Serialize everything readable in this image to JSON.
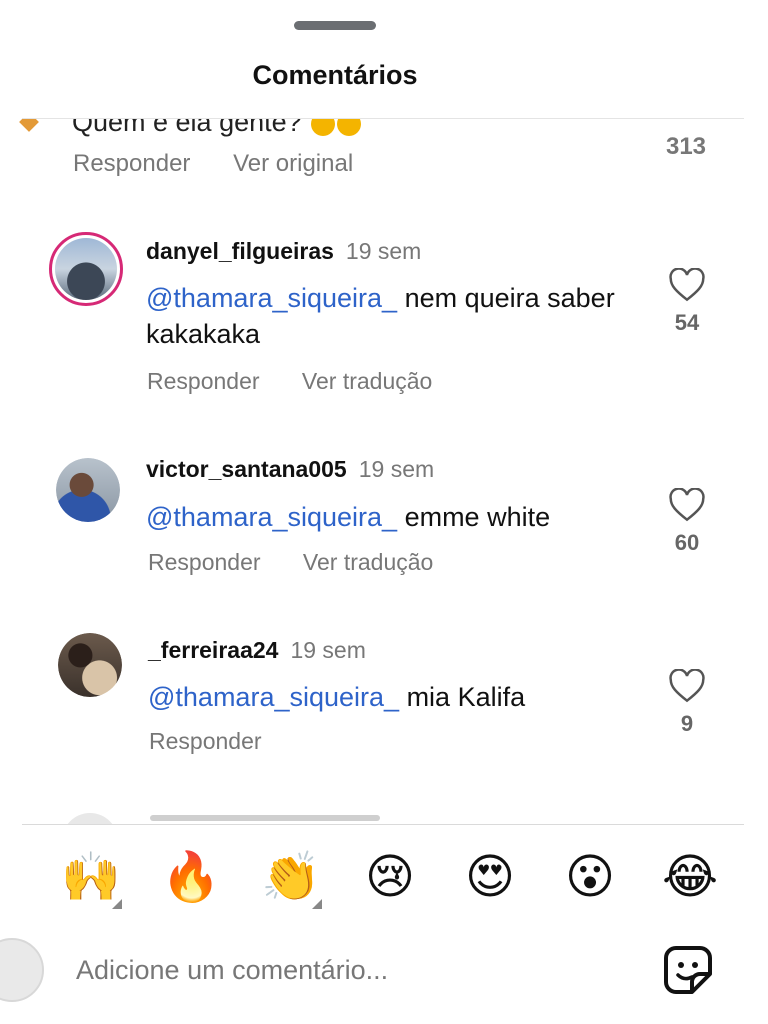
{
  "header": {
    "title": "Comentários"
  },
  "partial_comment": {
    "text": "Quem é ela gente?",
    "actions": [
      "Responder",
      "Ver original"
    ],
    "likes": "313"
  },
  "comments": [
    {
      "username": "danyel_filgueiras",
      "time": "19 sem",
      "mention": "@thamara_siqueira_",
      "text": "nem queira saber kakakaka",
      "actions": [
        "Responder",
        "Ver tradução"
      ],
      "likes": "54"
    },
    {
      "username": "victor_santana005",
      "time": "19 sem",
      "mention": "@thamara_siqueira_",
      "text": "emme white",
      "actions": [
        "Responder",
        "Ver tradução"
      ],
      "likes": "60"
    },
    {
      "username": "_ferreiraa24",
      "time": "19 sem",
      "mention": "@thamara_siqueira_",
      "text": "mia Kalifa",
      "actions": [
        "Responder"
      ],
      "likes": "9"
    }
  ],
  "emoji_bar": {
    "emojis": [
      "🙌",
      "🔥",
      "👏",
      "😢",
      "😍",
      "😮",
      "😂"
    ]
  },
  "composer": {
    "placeholder": "Adicione um comentário...",
    "sticker_icon": "sticker-icon"
  },
  "colors": {
    "mention": "#2e63c9",
    "story_ring": "#d62976",
    "muted": "#777777"
  }
}
